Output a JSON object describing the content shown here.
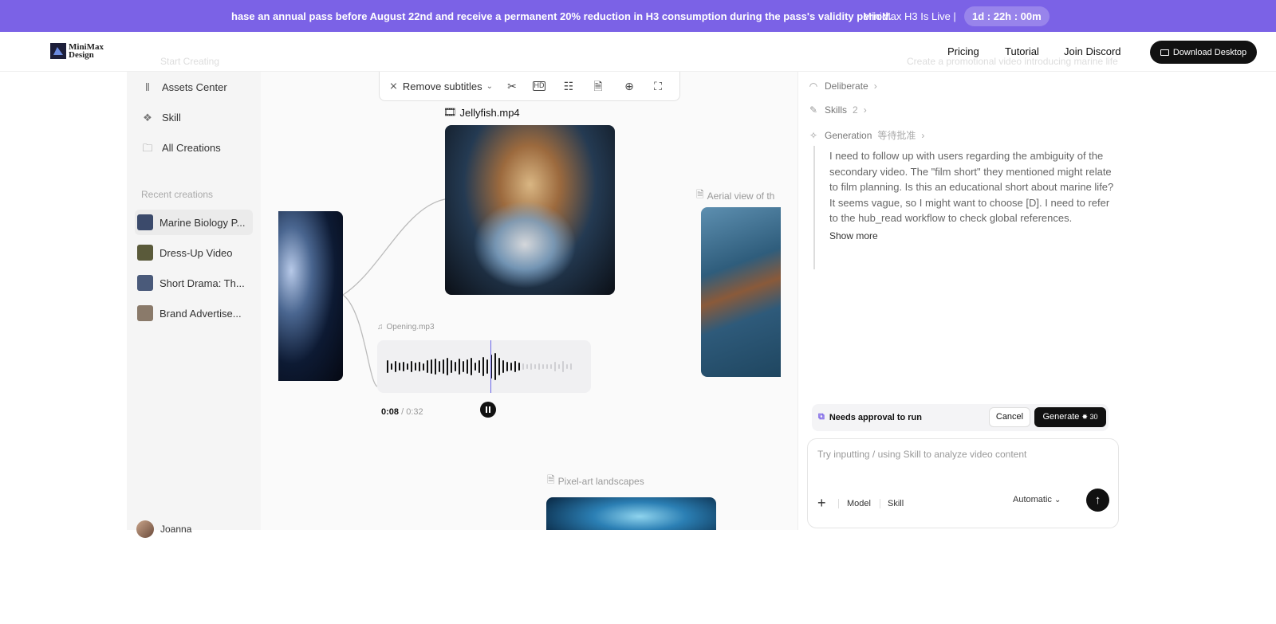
{
  "banner": {
    "message": "hase an annual pass before August 22nd and receive a permanent 20% reduction in H3 consumption during the pass's validity period.",
    "live": "MiniMax H3 Is Live |",
    "timer": "1d : 22h : 00m"
  },
  "header": {
    "logo_line1": "MiniMax",
    "logo_line2": "Design",
    "nav": [
      "Pricing",
      "Tutorial",
      "Join Discord"
    ],
    "download": "Download Desktop",
    "faded_left": "Start Creating",
    "faded_right": "Create a promotional video introducing marine life"
  },
  "sidebar": {
    "items": [
      {
        "label": "Assets Center",
        "icon": "library-icon"
      },
      {
        "label": "Skill",
        "icon": "puzzle-icon"
      },
      {
        "label": "All Creations",
        "icon": "folder-icon"
      }
    ],
    "recent_title": "Recent creations",
    "recent": [
      {
        "label": "Marine Biology P...",
        "color": "#3b4a6b"
      },
      {
        "label": "Dress-Up Video",
        "color": "#5a5a3a"
      },
      {
        "label": "Short Drama: Th...",
        "color": "#4a5a7a"
      },
      {
        "label": "Brand Advertise...",
        "color": "#8a7a6a"
      }
    ],
    "user": "Joanna"
  },
  "canvas": {
    "toolbar": {
      "subtitles": "Remove subtitles"
    },
    "jellyfish_label": "Jellyfish.mp4",
    "audio_label": "Opening.mp3",
    "aerial_label": "Aerial view of th",
    "pixel_label": "Pixel-art landscapes",
    "time_current": "0:08",
    "time_total": " / 0:32"
  },
  "panel": {
    "steps": [
      {
        "label": "Deliberate",
        "extra": "",
        "icon": "signal-icon"
      },
      {
        "label": "Skills",
        "extra": "2",
        "icon": "brush-icon"
      },
      {
        "label": "Generation",
        "extra": "等待批准",
        "icon": "sparkle-icon"
      }
    ],
    "thought": "I need to follow up with users regarding the ambiguity of the secondary video. The \"film short\" they mentioned might relate to film planning. Is this an educational short about marine life? It seems vague, so I might want to choose [D]. I need to refer to the hub_read workflow to check global references.",
    "show_more": "Show more",
    "approval": {
      "label": "Needs approval to run",
      "cancel": "Cancel",
      "generate": "Generate",
      "cost": "✸ 30"
    },
    "composer": {
      "placeholder": "Try inputting / using Skill to analyze video content",
      "model": "Model",
      "skill": "Skill",
      "mode": "Automatic"
    }
  }
}
